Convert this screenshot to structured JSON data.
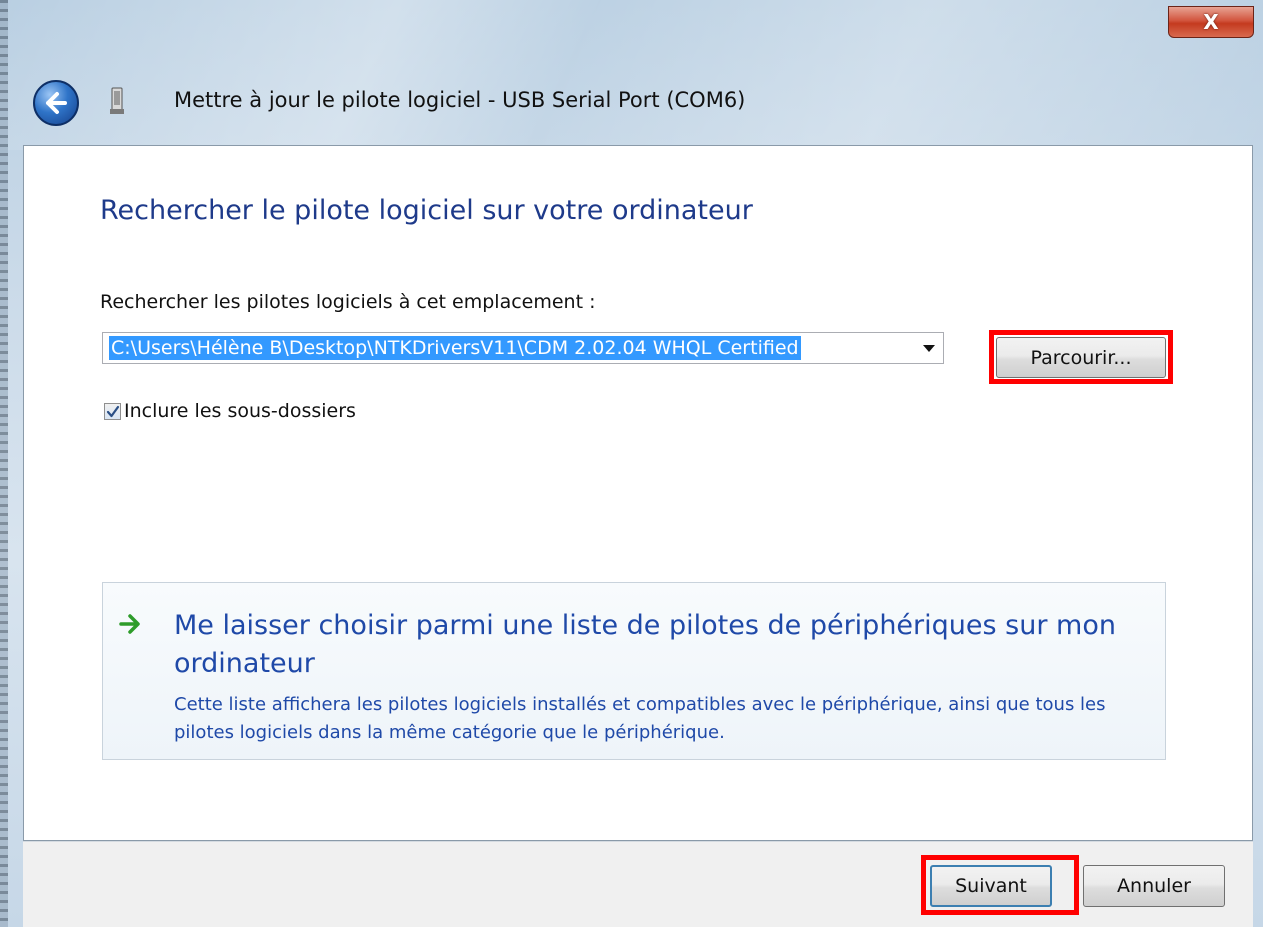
{
  "window": {
    "title": "Mettre à jour le pilote logiciel - USB Serial Port (COM6)",
    "close_label": "X"
  },
  "icons": {
    "back": "back-arrow-icon",
    "device": "usb-device-icon",
    "arrow": "green-arrow-icon",
    "check": "checkmark-icon"
  },
  "main": {
    "heading": "Rechercher le pilote logiciel sur votre ordinateur",
    "location_label": "Rechercher les pilotes logiciels à cet emplacement :",
    "path_value": "C:\\Users\\Hélène B\\Desktop\\NTKDriversV11\\CDM 2.02.04 WHQL Certified",
    "browse_label": "Parcourir...",
    "include_subfolders": {
      "label": "Inclure les sous-dossiers",
      "checked": true
    },
    "choose_option": {
      "title": "Me laisser choisir parmi une liste de pilotes de périphériques sur mon ordinateur",
      "description": "Cette liste affichera les pilotes logiciels installés et compatibles avec le périphérique, ainsi que tous les pilotes logiciels dans la même catégorie que le périphérique."
    }
  },
  "footer": {
    "next_label": "Suivant",
    "cancel_label": "Annuler"
  },
  "colors": {
    "accent_text": "#1e3a8a",
    "link_text": "#1f49a8",
    "highlight": "#ff0000",
    "selection": "#3399ff"
  }
}
